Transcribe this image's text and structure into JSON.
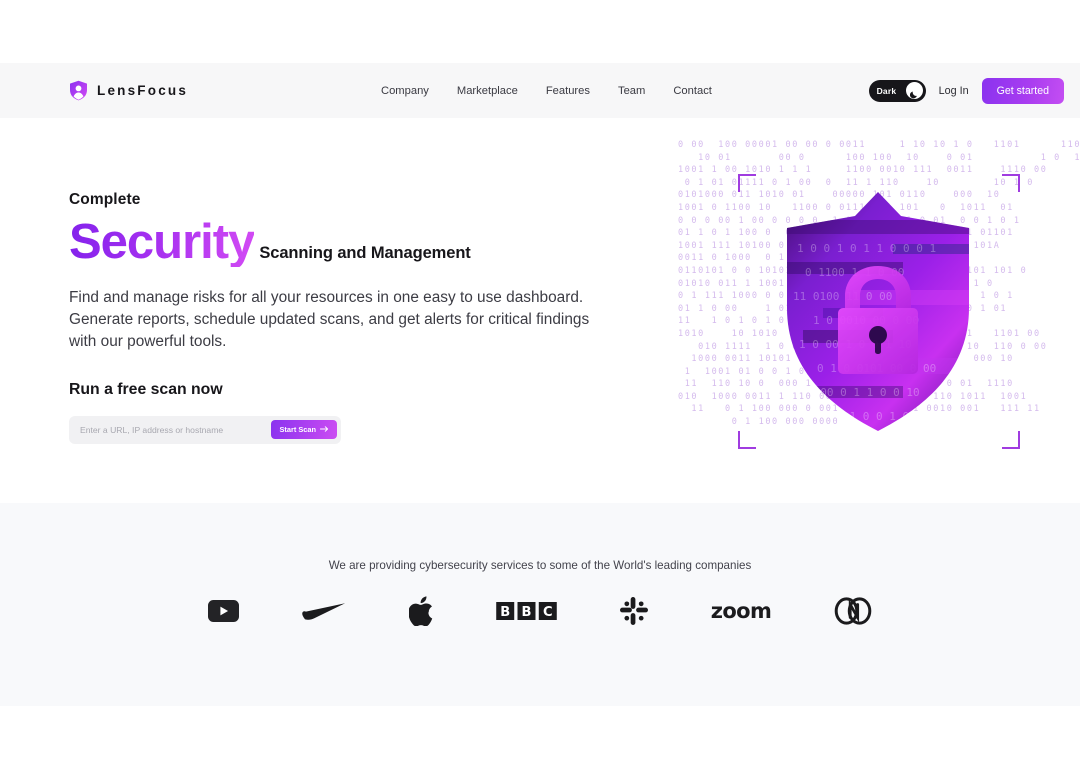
{
  "header": {
    "brand": {
      "name": "LensFocus",
      "icon": "shield-icon"
    },
    "nav": [
      {
        "label": "Company"
      },
      {
        "label": "Marketplace"
      },
      {
        "label": "Features"
      },
      {
        "label": "Team"
      },
      {
        "label": "Contact"
      }
    ],
    "theme_toggle": {
      "label": "Dark",
      "icon": "moon-icon",
      "state": "dark"
    },
    "login_label": "Log In",
    "cta_label": "Get started",
    "accent_start": "#8a33ef",
    "accent_end": "#c44ef2",
    "background": "#f7f7f8"
  },
  "hero": {
    "eyebrow": "Complete",
    "headline_accent": "Security",
    "headline_rest": "Scanning and Management",
    "description": "Find and manage risks for all your resources in one easy to use dashboard. Generate reports, schedule updated scans, and get alerts for critical findings with our powerful tools.",
    "scan_title": "Run a free scan now",
    "scan_placeholder": "Enter a URL, IP address or hostname",
    "scan_value": "",
    "scan_button_label": "Start Scan",
    "scan_button_icon": "arrow-right-icon",
    "art": {
      "alt": "shield-with-padlock-illustration",
      "shield_color_start": "#7a1fd0",
      "shield_color_end": "#e040fb",
      "binary_color": "#c9a8e8",
      "bracket_color": "#a03ce0",
      "binary_rows": [
        "0 00  100 00001 00 00 0 0011     1 10 10 1 0   1101      110 00",
        "   10 01       00 0      100 100  10    0 01          1 0  1",
        "1001 1 00 1010 1 1 1     1100 0010 111  0011    1110 00",
        " 0 1 01 01111 0 1 00  0  11 1 110    10        10 1 0",
        "0101000 011 1010 01    00000 101 0110    000  10",
        "1001 0 1100 10   1100 0 0111 0 1 101   0  1011  01",
        "0 0 0 00 1 00 0 0 0 0  1 0 1  0 0 1 0 01  0 0 1 0 1",
        "01 1 0 1 100 0  0 1 0 100  1 00 01   0 1 0 1 01101",
        "1001 111 10100 0 1 001 00 1 0 1 0 01 1 1001 101A",
        "0011 0 1000  0 1 0 100 0 11 0 1 10 111 0 0",
        "0110101 0 0 10101 0 0 10 0 1 0 1 0 10 0 0 0101 101 0",
        "01010 011 1 1001 1 0 0 1 0 1 0 1 1000 111   1 0",
        "0 1 111 1000 0 0 1 0 001 00 0 001 0 1 10 01  1 0 1",
        "01 1 0 00    1 01 0 1 0 1 00 1 0 1 0 1100  0 1 01",
        "11   1 0 1 0 1 0 1 1 0 0 1 1 0 1  0 0 0",
        "1010    10 1010     0 1 0 1 1100 01100 11 11   1101 00",
        "   010 1111  1 0 0 1 0 00 1100 11 1 1 0 00 10  110 0 00",
        "  1000 0011 10101 0  0 00 00 1000 11 0 00   000 10",
        " 1  1001 01 0 0 1 0 1 001 00 0 00 0  0 1",
        " 11  110 10 0  000 1 0 0 00 0 0 1 1 00  0 01  1110",
        "010  1000 0011 1 110 00 1 0 0 0 0 010 110 1011  1001",
        "  11   0 1 100 000 0 001 1 1 10 1111 0010 001   111 11",
        "        0 1 100 000 0000"
      ]
    }
  },
  "logos": {
    "caption": "We are providing cybersecurity services to some of the World's leading companies",
    "background": "#f8f9fb",
    "items": [
      {
        "name": "youtube-logo",
        "label": "YouTube"
      },
      {
        "name": "nike-logo",
        "label": "Nike"
      },
      {
        "name": "apple-logo",
        "label": "Apple"
      },
      {
        "name": "bbc-logo",
        "label": "BBC"
      },
      {
        "name": "slack-logo",
        "label": "Slack"
      },
      {
        "name": "zoom-logo",
        "label": "zoom"
      },
      {
        "name": "adobe-creative-cloud-logo",
        "label": "Adobe Creative Cloud"
      }
    ]
  }
}
